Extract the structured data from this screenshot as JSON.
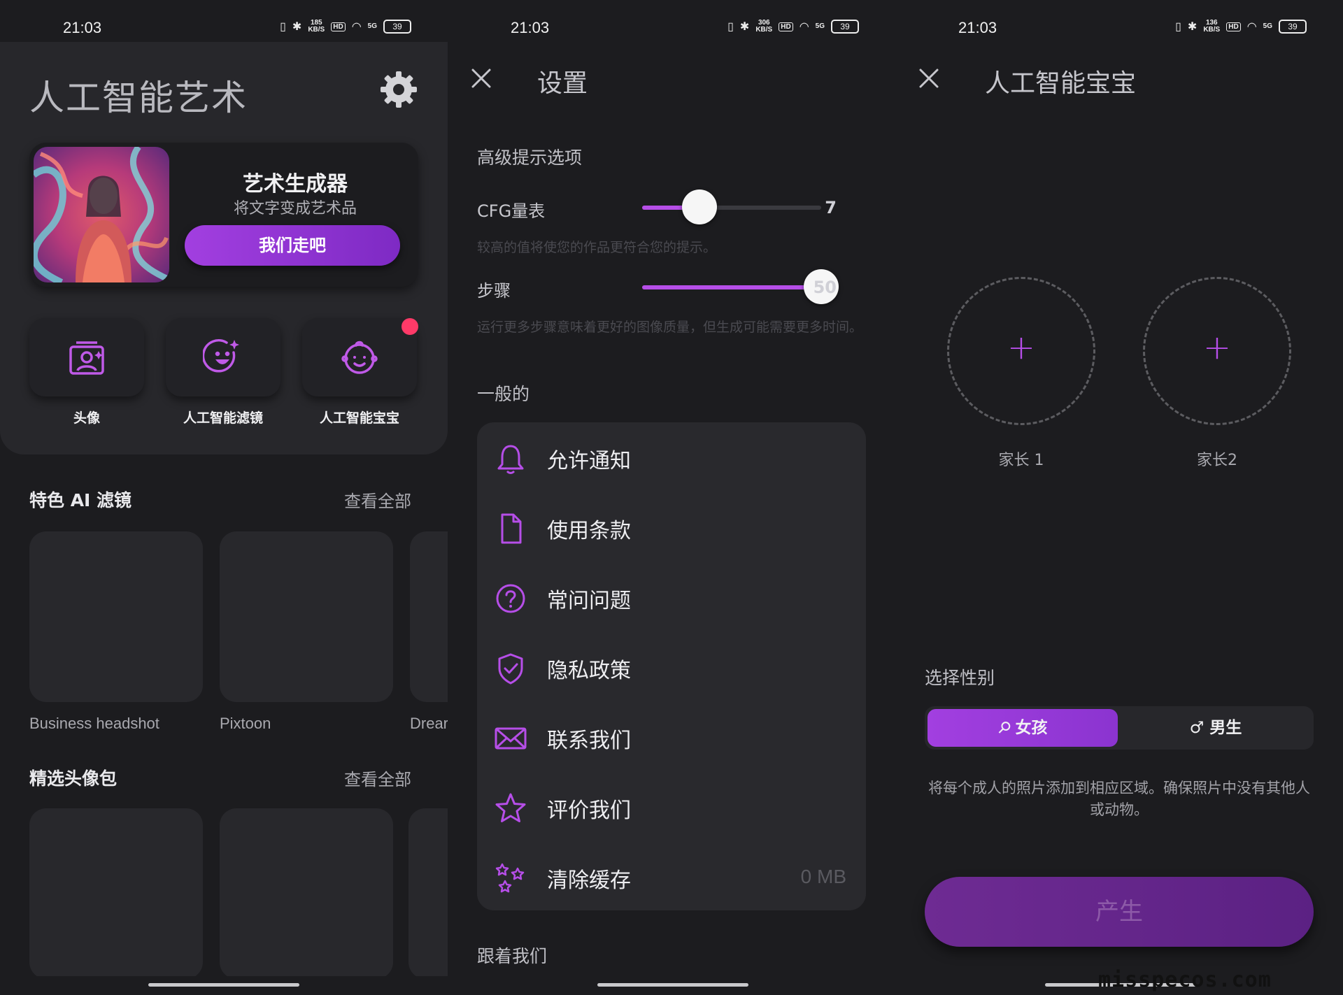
{
  "statusbars": [
    {
      "time": "21:03",
      "net_speed": "185",
      "net_unit": "KB/S",
      "hd": "HD",
      "signal": "5G",
      "battery": "39"
    },
    {
      "time": "21:03",
      "net_speed": "306",
      "net_unit": "KB/S",
      "hd": "HD",
      "signal": "5G",
      "battery": "39"
    },
    {
      "time": "21:03",
      "net_speed": "136",
      "net_unit": "KB/S",
      "hd": "HD",
      "signal": "5G",
      "battery": "39"
    }
  ],
  "home": {
    "title": "人工智能艺术",
    "hero": {
      "title": "艺术生成器",
      "subtitle": "将文字变成艺术品",
      "button": "我们走吧"
    },
    "tiles": [
      {
        "label": "头像",
        "icon": "avatar-portrait-icon"
      },
      {
        "label": "人工智能滤镜",
        "icon": "smiley-sparkle-icon"
      },
      {
        "label": "人工智能宝宝",
        "icon": "baby-face-icon",
        "badge": true
      }
    ],
    "featured": {
      "title": "特色 AI 滤镜",
      "see_all": "查看全部",
      "items": [
        "Business headshot",
        "Pixtoon",
        "Drear"
      ]
    },
    "packs": {
      "title": "精选头像包",
      "see_all": "查看全部"
    }
  },
  "settings": {
    "title": "设置",
    "advanced_title": "高级提示选项",
    "cfg": {
      "label": "CFG量表",
      "value": "7",
      "fraction": 0.32,
      "hint": "较高的值将使您的作品更符合您的提示。"
    },
    "steps": {
      "label": "步骤",
      "value": "50",
      "fraction": 1.0,
      "hint": "运行更多步骤意味着更好的图像质量，但生成可能需要更多时间。"
    },
    "general_title": "一般的",
    "items": [
      {
        "label": "允许通知",
        "icon": "bell-icon",
        "value": ""
      },
      {
        "label": "使用条款",
        "icon": "document-icon",
        "value": ""
      },
      {
        "label": "常问问题",
        "icon": "question-circle-icon",
        "value": ""
      },
      {
        "label": "隐私政策",
        "icon": "shield-check-icon",
        "value": ""
      },
      {
        "label": "联系我们",
        "icon": "envelope-icon",
        "value": ""
      },
      {
        "label": "评价我们",
        "icon": "star-icon",
        "value": ""
      },
      {
        "label": "清除缓存",
        "icon": "sparkles-icon",
        "value": "0 MB"
      }
    ],
    "follow_title": "跟着我们"
  },
  "baby": {
    "title": "人工智能宝宝",
    "parent1": "家长 1",
    "parent2": "家长2",
    "plus": "+",
    "gender_title": "选择性别",
    "girl": "女孩",
    "boy": "男生",
    "selected_gender": "女孩",
    "note": "将每个成人的照片添加到相应区域。确保照片中没有其他人或动物。",
    "generate": "产生"
  },
  "watermark": "misspecos.com",
  "colors": {
    "accent": "#b64ee8",
    "button": "#9a3bdc",
    "badge": "#ff3a68",
    "background": "#1c1c1f"
  }
}
